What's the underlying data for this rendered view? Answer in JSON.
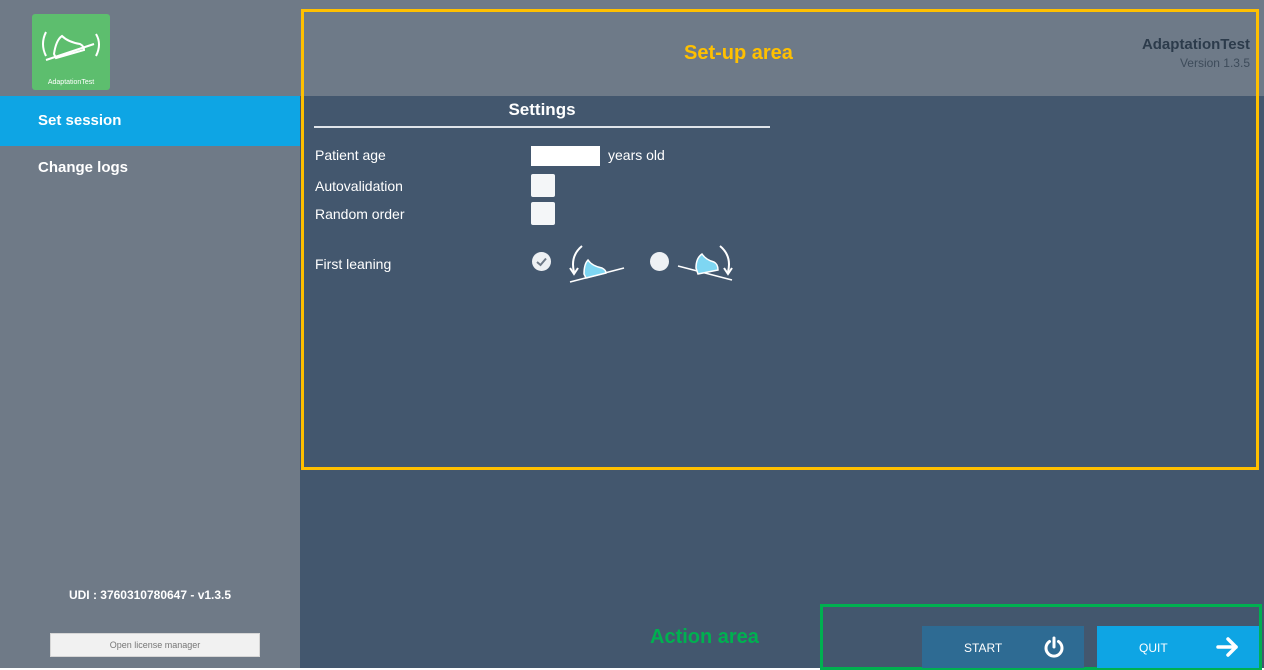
{
  "app": {
    "logo_text": "AdaptationTest",
    "name": "AdaptationTest",
    "version": "Version 1.3.5"
  },
  "sidebar": {
    "items": [
      {
        "label": "Set session",
        "active": true
      },
      {
        "label": "Change logs",
        "active": false
      }
    ],
    "udi": "UDI : 3760310780647 - v1.3.5",
    "license_button": "Open license manager"
  },
  "annotations": {
    "setup_area": "Set-up area",
    "action_area": "Action area"
  },
  "settings": {
    "title": "Settings",
    "patient_age_label": "Patient age",
    "patient_age_value": "",
    "years_label": "years old",
    "autovalidation_label": "Autovalidation",
    "autovalidation_checked": false,
    "random_order_label": "Random order",
    "random_order_checked": false,
    "first_leaning_label": "First leaning",
    "first_leaning_options": [
      {
        "icon": "lean-backward-icon",
        "selected": true
      },
      {
        "icon": "lean-forward-icon",
        "selected": false
      }
    ]
  },
  "actions": {
    "start_label": "START",
    "quit_label": "QUIT"
  },
  "colors": {
    "sidebar_bg": "#6f7a87",
    "active_item": "#0ea5e4",
    "main_bg": "#43576e",
    "setup_highlight": "#ffc000",
    "action_highlight": "#00b050",
    "start_button": "#2e6b93",
    "quit_button": "#0ea5e4"
  }
}
